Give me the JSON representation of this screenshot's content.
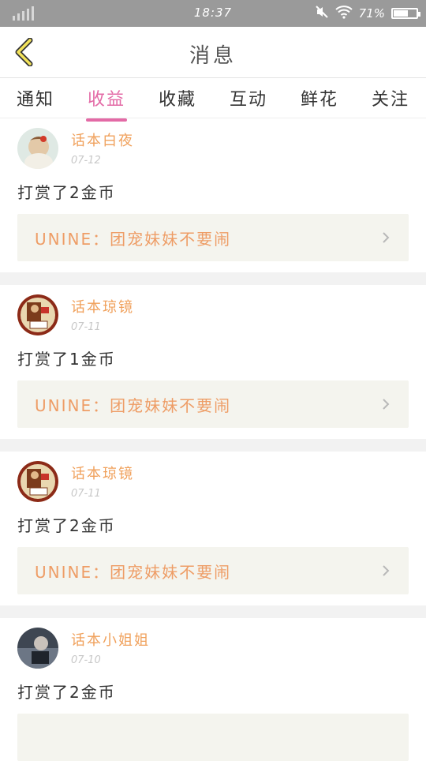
{
  "status": {
    "time": "18:37",
    "battery": "71%",
    "battery_level": 0.71
  },
  "header": {
    "title": "消息"
  },
  "tabs": [
    {
      "label": "通知",
      "active": false
    },
    {
      "label": "收益",
      "active": true
    },
    {
      "label": "收藏",
      "active": false
    },
    {
      "label": "互动",
      "active": false
    },
    {
      "label": "鲜花",
      "active": false
    },
    {
      "label": "关注",
      "active": false
    }
  ],
  "items": [
    {
      "user": "话本白夜",
      "date": "07-12",
      "text": "打赏了2金币",
      "quote": "UNINE：团宠妹妹不要闹",
      "avatar": "avatar-red-bow"
    },
    {
      "user": "话本琼镜",
      "date": "07-11",
      "text": "打赏了1金币",
      "quote": "UNINE：团宠妹妹不要闹",
      "avatar": "avatar-ancient"
    },
    {
      "user": "话本琼镜",
      "date": "07-11",
      "text": "打赏了2金币",
      "quote": "UNINE：团宠妹妹不要闹",
      "avatar": "avatar-ancient"
    },
    {
      "user": "话本小姐姐",
      "date": "07-10",
      "text": "打赏了2金币",
      "quote": "",
      "avatar": "avatar-dark"
    }
  ],
  "colors": {
    "accent": "#e36aa6",
    "username": "#f0a15c",
    "quote_text": "#ee9d66",
    "quote_bg": "#f4f4ee"
  }
}
